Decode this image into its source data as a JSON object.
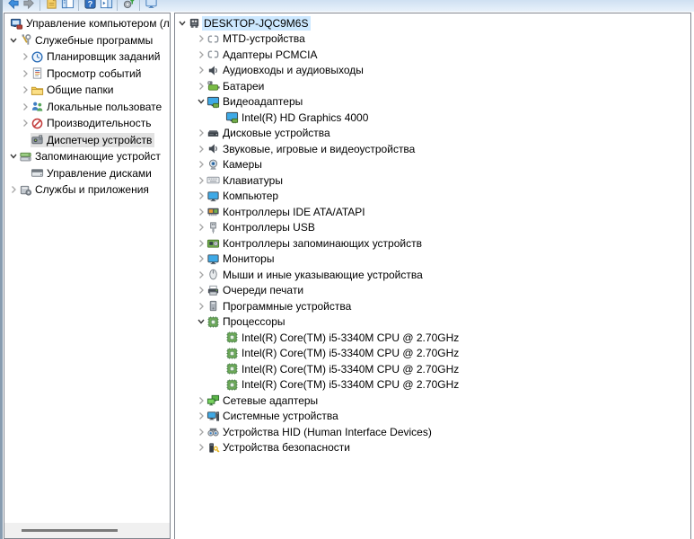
{
  "colors": {
    "selection_active_bg": "#cce8ff",
    "selection_inactive_bg": "#e2e2e2",
    "panel_border": "#828790",
    "toolbar_bg": "#d7e6f5",
    "cpu_icon_green": "#7ab55c",
    "monitor_icon_blue": "#3ea9e6"
  },
  "toolbar": {
    "items": [
      {
        "type": "button",
        "icon": "back-icon"
      },
      {
        "type": "button",
        "icon": "forward-icon"
      },
      {
        "type": "separator"
      },
      {
        "type": "button",
        "icon": "export-list-icon"
      },
      {
        "type": "button",
        "icon": "show-console-tree-icon"
      },
      {
        "type": "separator"
      },
      {
        "type": "button",
        "icon": "help-icon"
      },
      {
        "type": "button",
        "icon": "show-action-pane-icon"
      },
      {
        "type": "separator"
      },
      {
        "type": "button",
        "icon": "scan-hardware-changes-icon"
      },
      {
        "type": "separator"
      },
      {
        "type": "button",
        "icon": "remote-computer-icon"
      }
    ]
  },
  "left_tree": {
    "items": [
      {
        "label": "Управление компьютером (л",
        "icon": "computer-management-icon",
        "chevron": "none",
        "level": 0,
        "selected": "none"
      },
      {
        "label": "Служебные программы",
        "icon": "tools-icon",
        "chevron": "expanded",
        "level": 1,
        "selected": "none"
      },
      {
        "label": "Планировщик заданий",
        "icon": "task-scheduler-icon",
        "chevron": "collapsed",
        "level": 2,
        "selected": "none"
      },
      {
        "label": "Просмотр событий",
        "icon": "event-viewer-icon",
        "chevron": "collapsed",
        "level": 2,
        "selected": "none"
      },
      {
        "label": "Общие папки",
        "icon": "shared-folders-icon",
        "chevron": "collapsed",
        "level": 2,
        "selected": "none"
      },
      {
        "label": "Локальные пользовате",
        "icon": "local-users-icon",
        "chevron": "collapsed",
        "level": 2,
        "selected": "none"
      },
      {
        "label": "Производительность",
        "icon": "performance-icon",
        "chevron": "collapsed",
        "level": 2,
        "selected": "none"
      },
      {
        "label": "Диспетчер устройств",
        "icon": "device-manager-icon",
        "chevron": "none",
        "level": 2,
        "selected": "inactive"
      },
      {
        "label": "Запоминающие устройст",
        "icon": "storage-devices-icon",
        "chevron": "expanded",
        "level": 1,
        "selected": "none"
      },
      {
        "label": "Управление дисками",
        "icon": "disk-management-icon",
        "chevron": "none",
        "level": 2,
        "selected": "none"
      },
      {
        "label": "Службы и приложения",
        "icon": "services-icon",
        "chevron": "collapsed",
        "level": 1,
        "selected": "none"
      }
    ]
  },
  "right_tree": {
    "items": [
      {
        "label": "DESKTOP-JQC9M6S",
        "icon": "computer-icon",
        "chevron": "expanded",
        "level": 0,
        "selected": "active"
      },
      {
        "label": "MTD-устройства",
        "icon": "card-icon",
        "chevron": "collapsed",
        "level": 1,
        "selected": "none"
      },
      {
        "label": "Адаптеры PCMCIA",
        "icon": "card-icon",
        "chevron": "collapsed",
        "level": 1,
        "selected": "none"
      },
      {
        "label": "Аудиовходы и аудиовыходы",
        "icon": "audio-icon",
        "chevron": "collapsed",
        "level": 1,
        "selected": "none"
      },
      {
        "label": "Батареи",
        "icon": "battery-icon",
        "chevron": "collapsed",
        "level": 1,
        "selected": "none"
      },
      {
        "label": "Видеоадаптеры",
        "icon": "video-adapter-icon",
        "chevron": "expanded",
        "level": 1,
        "selected": "none"
      },
      {
        "label": "Intel(R) HD Graphics 4000",
        "icon": "video-adapter-icon",
        "chevron": "none",
        "level": 2,
        "selected": "none"
      },
      {
        "label": "Дисковые устройства",
        "icon": "disk-drive-icon",
        "chevron": "collapsed",
        "level": 1,
        "selected": "none"
      },
      {
        "label": "Звуковые, игровые и видеоустройства",
        "icon": "audio-icon",
        "chevron": "collapsed",
        "level": 1,
        "selected": "none"
      },
      {
        "label": "Камеры",
        "icon": "camera-icon",
        "chevron": "collapsed",
        "level": 1,
        "selected": "none"
      },
      {
        "label": "Клавиатуры",
        "icon": "keyboard-icon",
        "chevron": "collapsed",
        "level": 1,
        "selected": "none"
      },
      {
        "label": "Компьютер",
        "icon": "monitor-icon",
        "chevron": "collapsed",
        "level": 1,
        "selected": "none"
      },
      {
        "label": "Контроллеры IDE ATA/ATAPI",
        "icon": "ide-controller-icon",
        "chevron": "collapsed",
        "level": 1,
        "selected": "none"
      },
      {
        "label": "Контроллеры USB",
        "icon": "usb-icon",
        "chevron": "collapsed",
        "level": 1,
        "selected": "none"
      },
      {
        "label": "Контроллеры запоминающих устройств",
        "icon": "storage-controller-icon",
        "chevron": "collapsed",
        "level": 1,
        "selected": "none"
      },
      {
        "label": "Мониторы",
        "icon": "monitor-icon",
        "chevron": "collapsed",
        "level": 1,
        "selected": "none"
      },
      {
        "label": "Мыши и иные указывающие устройства",
        "icon": "mouse-icon",
        "chevron": "collapsed",
        "level": 1,
        "selected": "none"
      },
      {
        "label": "Очереди печати",
        "icon": "printer-icon",
        "chevron": "collapsed",
        "level": 1,
        "selected": "none"
      },
      {
        "label": "Программные устройства",
        "icon": "software-device-icon",
        "chevron": "collapsed",
        "level": 1,
        "selected": "none"
      },
      {
        "label": "Процессоры",
        "icon": "cpu-icon",
        "chevron": "expanded",
        "level": 1,
        "selected": "none"
      },
      {
        "label": "Intel(R) Core(TM) i5-3340M CPU @ 2.70GHz",
        "icon": "cpu-icon",
        "chevron": "none",
        "level": 2,
        "selected": "none"
      },
      {
        "label": "Intel(R) Core(TM) i5-3340M CPU @ 2.70GHz",
        "icon": "cpu-icon",
        "chevron": "none",
        "level": 2,
        "selected": "none"
      },
      {
        "label": "Intel(R) Core(TM) i5-3340M CPU @ 2.70GHz",
        "icon": "cpu-icon",
        "chevron": "none",
        "level": 2,
        "selected": "none"
      },
      {
        "label": "Intel(R) Core(TM) i5-3340M CPU @ 2.70GHz",
        "icon": "cpu-icon",
        "chevron": "none",
        "level": 2,
        "selected": "none"
      },
      {
        "label": "Сетевые адаптеры",
        "icon": "network-adapter-icon",
        "chevron": "collapsed",
        "level": 1,
        "selected": "none"
      },
      {
        "label": "Системные устройства",
        "icon": "system-device-icon",
        "chevron": "collapsed",
        "level": 1,
        "selected": "none"
      },
      {
        "label": "Устройства HID (Human Interface Devices)",
        "icon": "hid-icon",
        "chevron": "collapsed",
        "level": 1,
        "selected": "none"
      },
      {
        "label": "Устройства безопасности",
        "icon": "security-device-icon",
        "chevron": "collapsed",
        "level": 1,
        "selected": "none"
      }
    ]
  }
}
